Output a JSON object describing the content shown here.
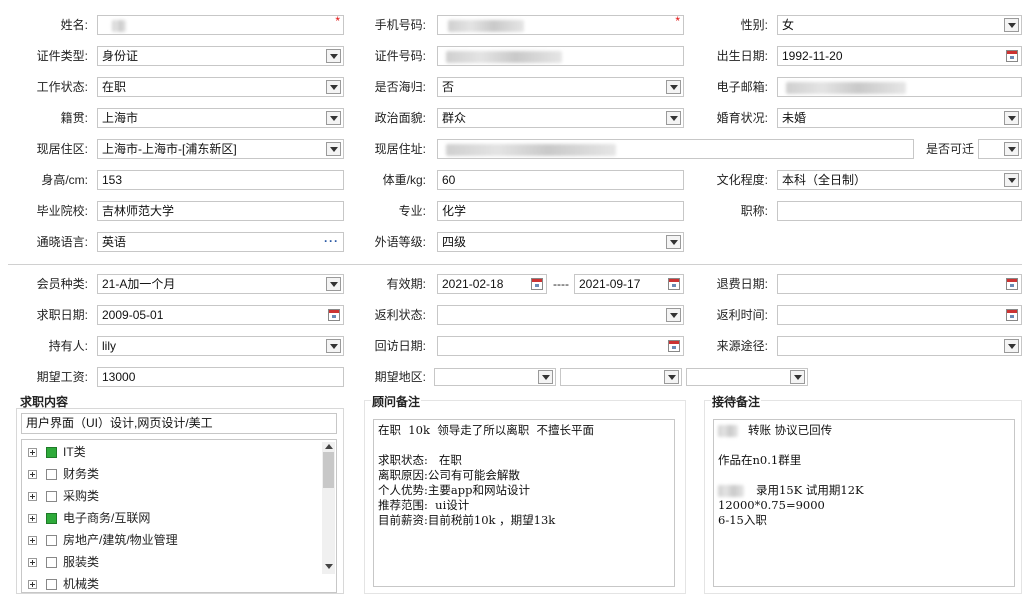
{
  "row1": {
    "name_label": "姓名:",
    "phone_label": "手机号码:",
    "gender_label": "性别:",
    "gender_value": "女",
    "required_mark": "*"
  },
  "row2": {
    "id_type_label": "证件类型:",
    "id_type_value": "身份证",
    "id_no_label": "证件号码:",
    "birth_label": "出生日期:",
    "birth_value": "1992-11-20"
  },
  "row3": {
    "work_label": "工作状态:",
    "work_value": "在职",
    "overseas_label": "是否海归:",
    "overseas_value": "否",
    "email_label": "电子邮箱:"
  },
  "row4": {
    "native_label": "籍贯:",
    "native_value": "上海市",
    "political_label": "政治面貌:",
    "political_value": "群众",
    "marital_label": "婚育状况:",
    "marital_value": "未婚"
  },
  "row5": {
    "region_label": "现居住区:",
    "region_value": "上海市-上海市-[浦东新区]",
    "address_label": "现居住址:",
    "relocate_label": "是否可迁"
  },
  "row6": {
    "height_label": "身高/cm:",
    "height_value": "153",
    "weight_label": "体重/kg:",
    "weight_value": "60",
    "edu_label": "文化程度:",
    "edu_value": "本科（全日制）"
  },
  "row7": {
    "school_label": "毕业院校:",
    "school_value": "吉林师范大学",
    "major_label": "专业:",
    "major_value": "化学",
    "title_label": "职称:"
  },
  "row8": {
    "lang_label": "通晓语言:",
    "lang_value": "英语",
    "lang_level_label": "外语等级:",
    "lang_level_value": "四级",
    "more_glyph": "···"
  },
  "member": {
    "type_label": "会员种类:",
    "type_value": "21-A加一个月",
    "valid_label": "有效期:",
    "valid_from": "2021-02-18",
    "valid_sep": "----",
    "valid_to": "2021-09-17",
    "refund_label": "退费日期:",
    "job_date_label": "求职日期:",
    "job_date_value": "2009-05-01",
    "rebate_status_label": "返利状态:",
    "rebate_time_label": "返利时间:",
    "holder_label": "持有人:",
    "holder_value": "lily",
    "visit_label": "回访日期:",
    "source_label": "来源途径:",
    "salary_label": "期望工资:",
    "salary_value": "13000",
    "area_label": "期望地区:"
  },
  "job_content": {
    "title": "求职内容",
    "selected": "用户界面（UI）设计,网页设计/美工",
    "tree": [
      {
        "label": "IT类",
        "checked": true
      },
      {
        "label": "财务类",
        "checked": false
      },
      {
        "label": "采购类",
        "checked": false
      },
      {
        "label": "电子商务/互联网",
        "checked": true
      },
      {
        "label": "房地产/建筑/物业管理",
        "checked": false
      },
      {
        "label": "服装类",
        "checked": false
      },
      {
        "label": "机械类",
        "checked": false
      }
    ]
  },
  "consultant": {
    "title": "顾问备注",
    "text": "在职  10k  领导走了所以离职  不擅长平面\n\n求职状态:   在职\n离职原因:公司有可能会解散\n个人优势:主要app和网站设计\n推荐范围:  ui设计\n目前薪资:目前税前10k ，期望13k"
  },
  "receiver": {
    "title": "接待备注",
    "line1": "转账 协议已回传",
    "line2": "作品在n0.1群里",
    "line3": "录用15K 试用期12K",
    "line4": "12000*0.75=9000",
    "line5": "6-15入职"
  }
}
